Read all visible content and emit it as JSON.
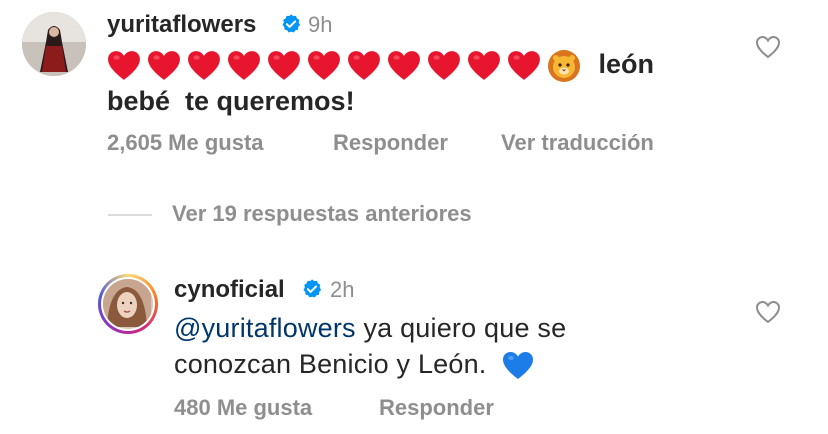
{
  "comment1": {
    "username": "yuritaflowers",
    "time": "9h",
    "text_emoji_prefix": "❤️❤️❤️❤️❤️❤️❤️❤️❤️❤️❤️🦁",
    "text_line1": "león",
    "text_line2": "bebé  te queremos!",
    "likes": "2,605 Me gusta",
    "reply": "Responder",
    "translate": "Ver traducción"
  },
  "view_replies": "Ver 19 respuestas anteriores",
  "comment2": {
    "username": "cynoficial",
    "time": "2h",
    "mention": "@yuritaflowers",
    "text_line1": " ya quiero que se",
    "text_line2": "conozcan Benicio y León.",
    "likes": "480 Me gusta",
    "reply": "Responder"
  },
  "colors": {
    "verified_blue": "#0095f6",
    "heart_red": "#e8152e",
    "mention_blue": "#00376b",
    "secondary_gray": "#8e8e8e"
  },
  "icons": [
    "verified-icon",
    "heart-outline-icon",
    "red-heart-emoji",
    "lion-emoji",
    "blue-heart-emoji"
  ]
}
